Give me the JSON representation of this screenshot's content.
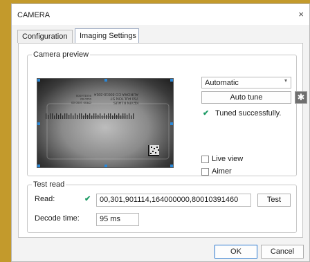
{
  "window": {
    "title": "CAMERA",
    "close_glyph": "×"
  },
  "tabs": [
    {
      "label": "Configuration",
      "active": false
    },
    {
      "label": "Imaging Settings",
      "active": true
    }
  ],
  "camera_preview": {
    "group_label": "Camera preview",
    "mode_select": {
      "value": "Automatic",
      "arrow": "▾"
    },
    "auto_tune_label": "Auto tune",
    "settings_icon": "gear-icon",
    "settings_glyph": "✱",
    "status_check": "✔",
    "status_text": "Tuned successfully.",
    "live_view_label": "Live view",
    "aimer_label": "Aimer",
    "image_text": [
      "Printed with a demonstration copy of ...",
      "KEVIN KLAUS",
      "760 FULTON ST",
      "AURORA CO 80010-3914",
      "CR00 1000 00",
      "0110 00",
      "910114000"
    ]
  },
  "test_read": {
    "group_label": "Test read",
    "read_label": "Read:",
    "read_check": "✔",
    "read_value": "00,301,901114,164000000,80010391460",
    "test_button_label": "Test",
    "decode_time_label": "Decode time:",
    "decode_time_value": "95 ms"
  },
  "footer": {
    "ok_label": "OK",
    "cancel_label": "Cancel"
  },
  "colors": {
    "accent": "#2a88d8",
    "success": "#1a9a63",
    "desktop": "#c39a2c"
  }
}
